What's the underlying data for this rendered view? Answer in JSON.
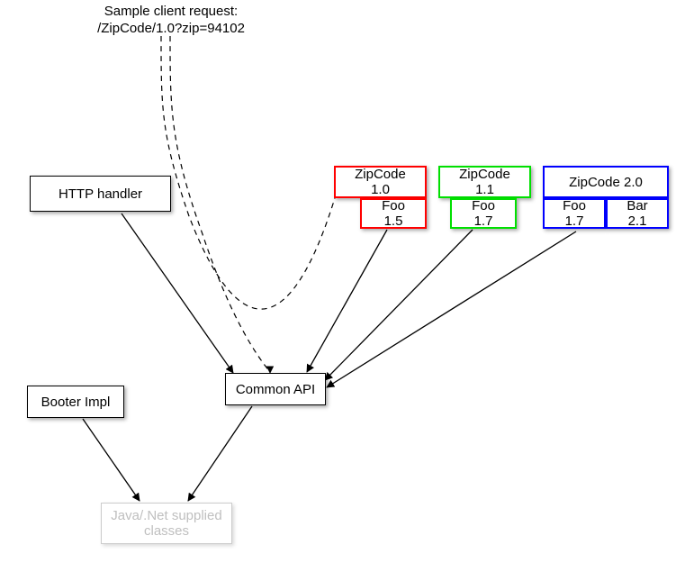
{
  "caption": {
    "line1": "Sample client request:",
    "line2": "/ZipCode/1.0?zip=94102"
  },
  "nodes": {
    "http_handler": "HTTP handler",
    "booter_impl": "Booter Impl",
    "common_api": "Common API",
    "java_net": "Java/.Net supplied classes",
    "zip10": {
      "main": "ZipCode 1.0",
      "dep1": "Foo 1.5"
    },
    "zip11": {
      "main": "ZipCode 1.1",
      "dep1": "Foo 1.7"
    },
    "zip20": {
      "main": "ZipCode 2.0",
      "dep1": "Foo 1.7",
      "dep2": "Bar 2.1"
    }
  },
  "colors": {
    "red": "#ff0000",
    "green": "#00e000",
    "blue": "#0000ff"
  }
}
